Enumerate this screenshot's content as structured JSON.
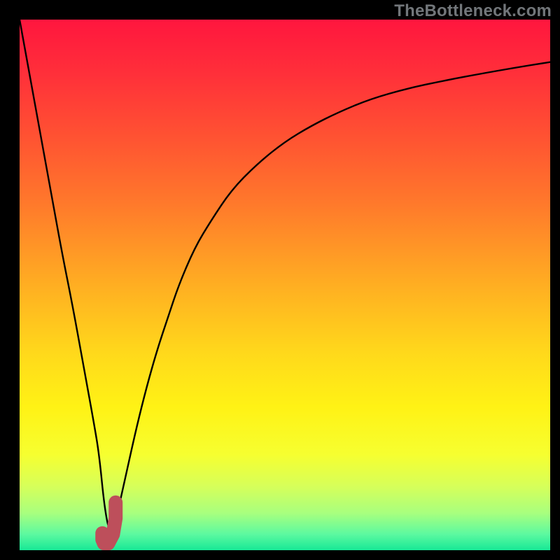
{
  "watermark": "TheBottleneck.com",
  "colors": {
    "frame": "#000000",
    "curve": "#000000",
    "marker_fill": "#bd4f5b",
    "gradient_stops": [
      {
        "offset": 0.0,
        "color": "#ff163e"
      },
      {
        "offset": 0.1,
        "color": "#ff2f3a"
      },
      {
        "offset": 0.22,
        "color": "#ff5232"
      },
      {
        "offset": 0.35,
        "color": "#ff7a2b"
      },
      {
        "offset": 0.5,
        "color": "#ffae22"
      },
      {
        "offset": 0.63,
        "color": "#ffd91b"
      },
      {
        "offset": 0.73,
        "color": "#fff215"
      },
      {
        "offset": 0.82,
        "color": "#f6ff30"
      },
      {
        "offset": 0.88,
        "color": "#d6ff5a"
      },
      {
        "offset": 0.93,
        "color": "#a8ff7e"
      },
      {
        "offset": 0.97,
        "color": "#5cf9a0"
      },
      {
        "offset": 1.0,
        "color": "#17e896"
      }
    ]
  },
  "chart_data": {
    "type": "line",
    "title": "",
    "xlabel": "",
    "ylabel": "",
    "xlim": [
      0,
      100
    ],
    "ylim": [
      0,
      100
    ],
    "grid": false,
    "legend": false,
    "series": [
      {
        "name": "bottleneck_curve",
        "x": [
          0,
          2,
          4,
          6,
          8,
          10,
          12,
          14,
          15,
          16,
          17,
          18,
          20,
          22,
          24,
          26,
          28,
          30,
          33,
          36,
          40,
          45,
          50,
          55,
          60,
          66,
          73,
          80,
          88,
          95,
          100
        ],
        "values": [
          100,
          89,
          78,
          67,
          56,
          46,
          35,
          24,
          18,
          8,
          3,
          5,
          14,
          23,
          31,
          38,
          44,
          50,
          57,
          62,
          68,
          73,
          77,
          80,
          82.5,
          85,
          87,
          88.5,
          90,
          91.2,
          92
        ]
      }
    ],
    "marker": {
      "name": "J-marker",
      "x": [
        15.6,
        15.6,
        15.9,
        16.7,
        17.6,
        18.1,
        18.1
      ],
      "y": [
        3.2,
        2.0,
        1.3,
        1.3,
        3.0,
        6.0,
        9.0
      ]
    }
  }
}
